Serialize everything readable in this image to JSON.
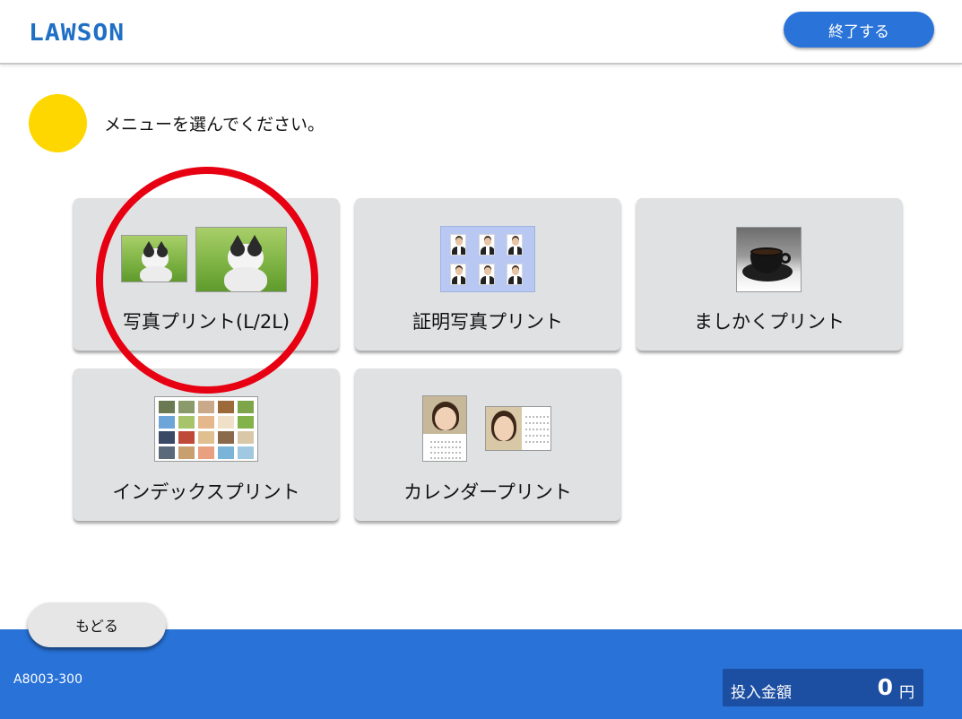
{
  "header": {
    "logo": "LAWSON",
    "exit_label": "終了する"
  },
  "instruction": {
    "text": "メニューを選んでください。"
  },
  "menu": {
    "photo_print": "写真プリント(L/2L)",
    "id_photo_print": "証明写真プリント",
    "mashikaku_print": "ましかくプリント",
    "index_print": "インデックスプリント",
    "calendar_print": "カレンダープリント"
  },
  "footer": {
    "back_label": "もどる",
    "screen_code": "A8003-300",
    "amount_label": "投入金額",
    "amount_value": "0",
    "amount_unit": "円"
  },
  "colors": {
    "brand_blue": "#2872d8",
    "indicator_yellow": "#ffd700",
    "highlight_red": "#e60012"
  }
}
